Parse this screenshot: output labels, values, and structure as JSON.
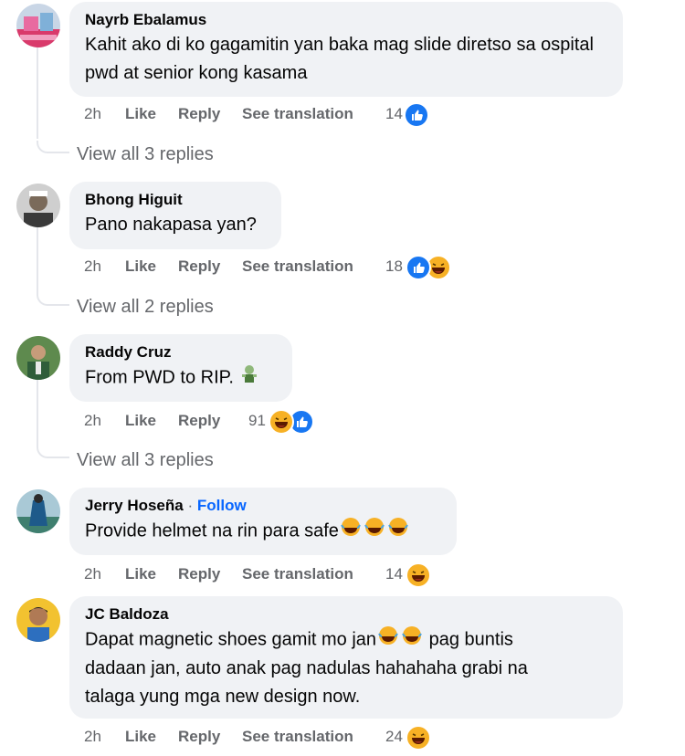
{
  "comments": [
    {
      "author": "Nayrb Ebalamus",
      "text": "Kahit ako di ko gagamitin yan baka mag slide diretso sa ospital pwd at senior kong kasama",
      "time": "2h",
      "like_label": "Like",
      "reply_label": "Reply",
      "translate_label": "See translation",
      "reaction_count": "14",
      "reactions": [
        "like"
      ],
      "view_replies": "View all 3 replies"
    },
    {
      "author": "Bhong Higuit",
      "text": "Pano nakapasa yan?",
      "time": "2h",
      "like_label": "Like",
      "reply_label": "Reply",
      "translate_label": "See translation",
      "reaction_count": "18",
      "reactions": [
        "like",
        "haha"
      ],
      "view_replies": "View all 2 replies"
    },
    {
      "author": "Raddy Cruz",
      "text": "From PWD to RIP.",
      "time": "2h",
      "like_label": "Like",
      "reply_label": "Reply",
      "reaction_count": "91",
      "reactions": [
        "haha",
        "like"
      ],
      "view_replies": "View all 3 replies"
    },
    {
      "author": "Jerry Hoseña",
      "follow_label": "Follow",
      "text": "Provide helmet na rin para safe",
      "time": "2h",
      "like_label": "Like",
      "reply_label": "Reply",
      "translate_label": "See translation",
      "reaction_count": "14",
      "reactions": [
        "haha"
      ]
    },
    {
      "author": "JC Baldoza",
      "text_line1": "Dapat magnetic shoes gamit mo jan",
      "text_line1b": "pag buntis",
      "text_line2": "dadaan jan, auto anak pag nadulas hahahaha grabi na",
      "text_line3": "talaga yung mga new design now.",
      "time": "2h",
      "like_label": "Like",
      "reply_label": "Reply",
      "translate_label": "See translation",
      "reaction_count": "24",
      "reactions": [
        "haha"
      ]
    }
  ],
  "colors": {
    "bubble": "#f0f2f5",
    "secondary_text": "#65676b",
    "link_blue": "#0866ff",
    "like_blue": "#1877f2",
    "haha_yellow": "#f7b125"
  }
}
